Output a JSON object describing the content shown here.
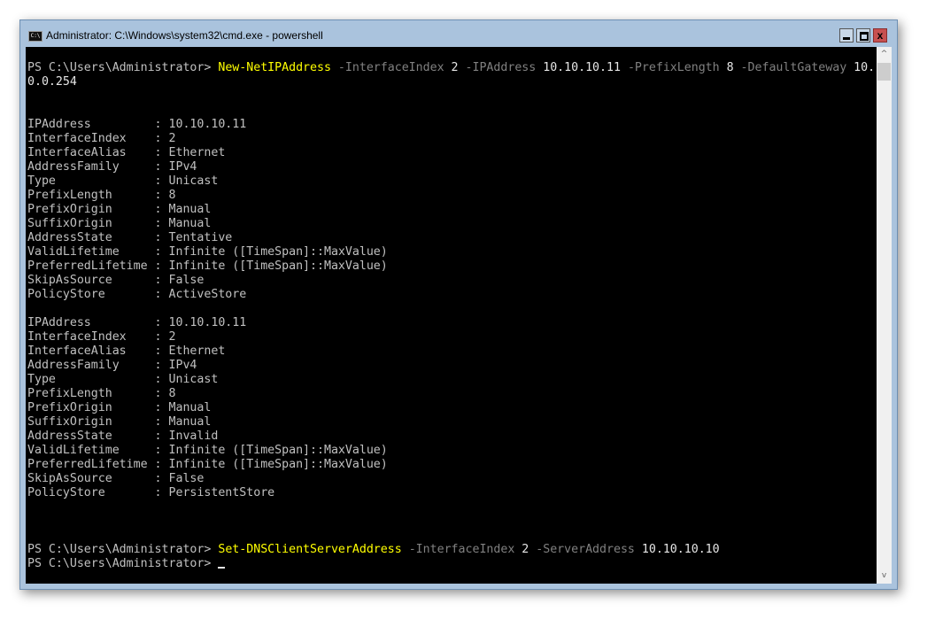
{
  "window": {
    "title": "Administrator: C:\\Windows\\system32\\cmd.exe - powershell",
    "icon_label": "C:\\",
    "close_label": "x"
  },
  "scrollbar": {
    "up": "^",
    "down": "v"
  },
  "colors": {
    "command": "#ffff00",
    "param": "#808080",
    "value": "#e6e6e6",
    "text": "#c0c0c0",
    "background": "#000000"
  },
  "terminal": {
    "lines": [
      [
        {
          "t": "PS C:\\Users\\Administrator> ",
          "c": ""
        },
        {
          "t": "New-NetIPAddress",
          "c": "cmd"
        },
        {
          "t": " -InterfaceIndex",
          "c": "param"
        },
        {
          "t": " 2",
          "c": "val"
        },
        {
          "t": " -IPAddress",
          "c": "param"
        },
        {
          "t": " 10.10.10.11",
          "c": "val"
        },
        {
          "t": " -PrefixLength",
          "c": "param"
        },
        {
          "t": " 8",
          "c": "val"
        },
        {
          "t": " -DefaultGateway",
          "c": "param"
        },
        {
          "t": " 10.",
          "c": "val"
        }
      ],
      [
        {
          "t": "0.0.254",
          "c": "val"
        }
      ],
      [],
      [],
      [
        {
          "t": "IPAddress         : 10.10.10.11",
          "c": ""
        }
      ],
      [
        {
          "t": "InterfaceIndex    : 2",
          "c": ""
        }
      ],
      [
        {
          "t": "InterfaceAlias    : Ethernet",
          "c": ""
        }
      ],
      [
        {
          "t": "AddressFamily     : IPv4",
          "c": ""
        }
      ],
      [
        {
          "t": "Type              : Unicast",
          "c": ""
        }
      ],
      [
        {
          "t": "PrefixLength      : 8",
          "c": ""
        }
      ],
      [
        {
          "t": "PrefixOrigin      : Manual",
          "c": ""
        }
      ],
      [
        {
          "t": "SuffixOrigin      : Manual",
          "c": ""
        }
      ],
      [
        {
          "t": "AddressState      : Tentative",
          "c": ""
        }
      ],
      [
        {
          "t": "ValidLifetime     : Infinite ([TimeSpan]::MaxValue)",
          "c": ""
        }
      ],
      [
        {
          "t": "PreferredLifetime : Infinite ([TimeSpan]::MaxValue)",
          "c": ""
        }
      ],
      [
        {
          "t": "SkipAsSource      : False",
          "c": ""
        }
      ],
      [
        {
          "t": "PolicyStore       : ActiveStore",
          "c": ""
        }
      ],
      [],
      [
        {
          "t": "IPAddress         : 10.10.10.11",
          "c": ""
        }
      ],
      [
        {
          "t": "InterfaceIndex    : 2",
          "c": ""
        }
      ],
      [
        {
          "t": "InterfaceAlias    : Ethernet",
          "c": ""
        }
      ],
      [
        {
          "t": "AddressFamily     : IPv4",
          "c": ""
        }
      ],
      [
        {
          "t": "Type              : Unicast",
          "c": ""
        }
      ],
      [
        {
          "t": "PrefixLength      : 8",
          "c": ""
        }
      ],
      [
        {
          "t": "PrefixOrigin      : Manual",
          "c": ""
        }
      ],
      [
        {
          "t": "SuffixOrigin      : Manual",
          "c": ""
        }
      ],
      [
        {
          "t": "AddressState      : Invalid",
          "c": ""
        }
      ],
      [
        {
          "t": "ValidLifetime     : Infinite ([TimeSpan]::MaxValue)",
          "c": ""
        }
      ],
      [
        {
          "t": "PreferredLifetime : Infinite ([TimeSpan]::MaxValue)",
          "c": ""
        }
      ],
      [
        {
          "t": "SkipAsSource      : False",
          "c": ""
        }
      ],
      [
        {
          "t": "PolicyStore       : PersistentStore",
          "c": ""
        }
      ],
      [],
      [],
      [],
      [
        {
          "t": "PS C:\\Users\\Administrator> ",
          "c": ""
        },
        {
          "t": "Set-DNSClientServerAddress",
          "c": "cmd"
        },
        {
          "t": " -InterfaceIndex",
          "c": "param"
        },
        {
          "t": " 2",
          "c": "val"
        },
        {
          "t": " -ServerAddress",
          "c": "param"
        },
        {
          "t": " 10.10.10.10",
          "c": "val"
        }
      ],
      [
        {
          "t": "PS C:\\Users\\Administrator> ",
          "c": ""
        }
      ]
    ]
  }
}
